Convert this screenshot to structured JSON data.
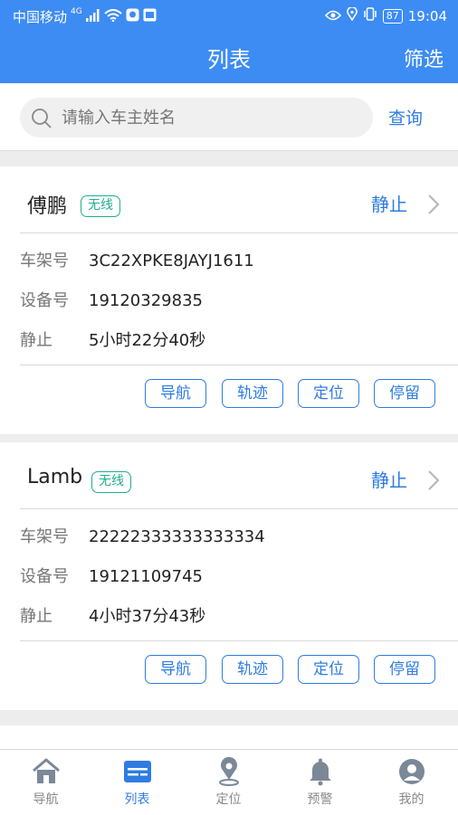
{
  "status_bar": {
    "carrier": "中国移动",
    "network": "4G",
    "battery": "87",
    "time": "19:04"
  },
  "header": {
    "title": "列表",
    "filter_label": "筛选"
  },
  "search": {
    "placeholder": "请输入车主姓名",
    "button_label": "查询"
  },
  "vehicles": [
    {
      "owner": "傅鹏",
      "connection_tag": "无线",
      "status": "静止",
      "fields": [
        {
          "label": "车架号",
          "value": "3C22XPKE8JAYJ1611"
        },
        {
          "label": "设备号",
          "value": "19120329835"
        },
        {
          "label": "静止",
          "value": "5小时22分40秒"
        }
      ],
      "actions": [
        "导航",
        "轨迹",
        "定位",
        "停留"
      ]
    },
    {
      "owner": "Lamb",
      "connection_tag": "无线",
      "status": "静止",
      "fields": [
        {
          "label": "车架号",
          "value": "22222333333333334"
        },
        {
          "label": "设备号",
          "value": "19121109745"
        },
        {
          "label": "静止",
          "value": "4小时37分43秒"
        }
      ],
      "actions": [
        "导航",
        "轨迹",
        "定位",
        "停留"
      ]
    }
  ],
  "tabs": [
    {
      "label": "导航",
      "icon": "home-icon",
      "active": false
    },
    {
      "label": "列表",
      "icon": "list-card-icon",
      "active": true
    },
    {
      "label": "定位",
      "icon": "location-pin-icon",
      "active": false
    },
    {
      "label": "预警",
      "icon": "bell-icon",
      "active": false
    },
    {
      "label": "我的",
      "icon": "user-avatar-icon",
      "active": false
    }
  ],
  "colors": {
    "primary_blue": "#3d8cf4",
    "accent_blue": "#2f7ce0",
    "tag_green": "#1fae8e",
    "tab_inactive": "#888888"
  }
}
